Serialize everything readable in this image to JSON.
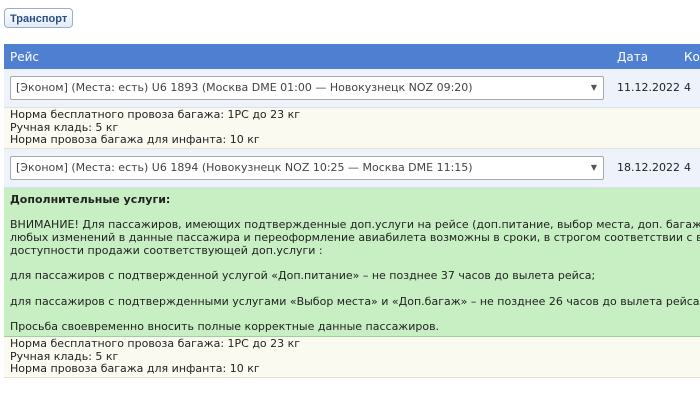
{
  "toolbar": {
    "transport_label": "Транспорт"
  },
  "table": {
    "headers": {
      "flight": "Рейс",
      "date": "Дата",
      "count": "Ко"
    },
    "flight1": {
      "select_value": "[Эконом] (Места: есть) U6 1893 (Москва DME 01:00 — Новокузнецк NOZ 09:20)",
      "date": "11.12.2022",
      "count": "4",
      "baggage": [
        "Норма бесплатного провоза багажа: 1PC до 23 кг",
        "Ручная кладь: 5 кг",
        "Норма провоза багажа для инфанта: 10 кг"
      ]
    },
    "flight2": {
      "select_value": "[Эконом] (Места: есть) U6 1894 (Новокузнецк NOZ 10:25 — Москва DME 11:15)",
      "date": "18.12.2022",
      "count": "4",
      "services": {
        "title": "Дополнительные услуги:",
        "notice_lines": [
          "ВНИМАНИЕ! Для пассажиров, имеющих подтвержденные доп.услуги на рейсе (доп.питание, выбор места, доп. багаж) вн",
          "любых изменений в данные пассажира и переоформление авиабилета возможны в сроки, в строгом соответствии с вре",
          "доступности продажи соответствующей доп.услуги :"
        ],
        "meal_rule": "для пассажиров с подтвержденной услугой «Доп.питание» – не позднее 37 часов до вылета рейса;",
        "seat_bag_rule": "для пассажиров с подтвержденными услугами «Выбор места» и «Доп.багаж» – не позднее 26 часов до вылета рейса.",
        "request": "Просьба своевременно вносить полные корректные данные пассажиров."
      },
      "baggage": [
        "Норма бесплатного провоза багажа: 1PC до 23 кг",
        "Ручная кладь: 5 кг",
        "Норма провоза багажа для инфанта: 10 кг"
      ]
    }
  }
}
